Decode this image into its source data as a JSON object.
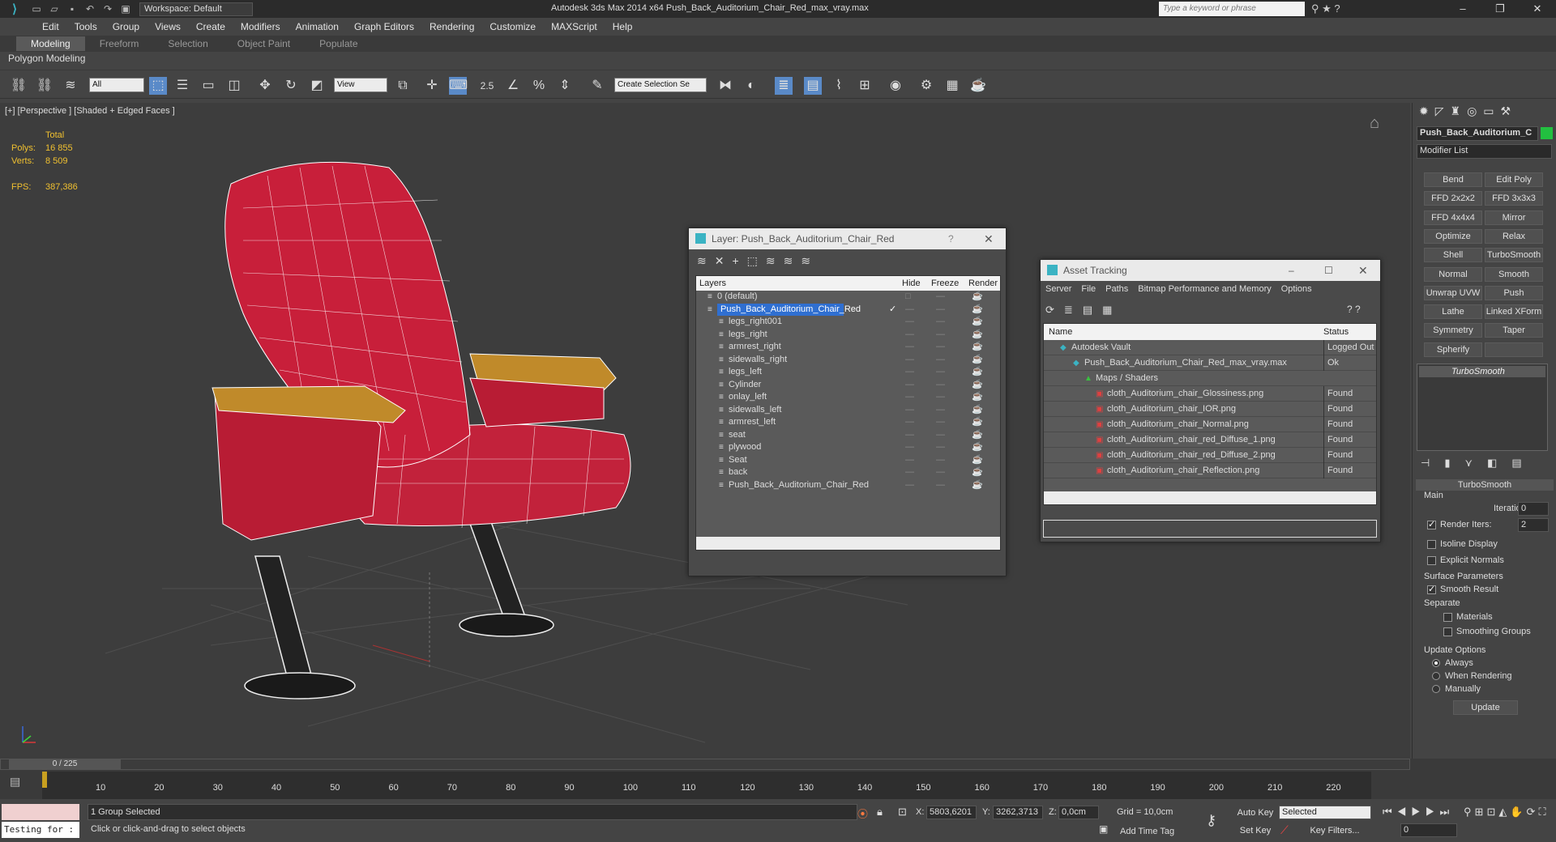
{
  "app": {
    "workspace": "Workspace: Default",
    "title": "Autodesk 3ds Max  2014 x64     Push_Back_Auditorium_Chair_Red_max_vray.max",
    "search_placeholder": "Type a keyword or phrase"
  },
  "menu": [
    "Edit",
    "Tools",
    "Group",
    "Views",
    "Create",
    "Modifiers",
    "Animation",
    "Graph Editors",
    "Rendering",
    "Customize",
    "MAXScript",
    "Help"
  ],
  "ribbon": {
    "tabs": [
      "Modeling",
      "Freeform",
      "Selection",
      "Object Paint",
      "Populate"
    ],
    "active": "Modeling",
    "subtitle": "Polygon Modeling"
  },
  "toolbar": {
    "filter": "All",
    "coord": "View",
    "snap_value": "2.5",
    "named_sel": "Create Selection Se"
  },
  "viewport": {
    "label": "[+] [Perspective ] [Shaded + Edged Faces ]",
    "stats": {
      "total_label": "Total",
      "polys_label": "Polys:",
      "polys": "16 855",
      "verts_label": "Verts:",
      "verts": "8 509",
      "fps_label": "FPS:",
      "fps": "387,386"
    }
  },
  "layer_dialog": {
    "title": "Layer: Push_Back_Auditorium_Chair_Red",
    "columns": [
      "Layers",
      "Hide",
      "Freeze",
      "Render"
    ],
    "rows": [
      {
        "name": "0 (default)",
        "level": 1
      },
      {
        "name": "Push_Back_Auditorium_Chair_Red",
        "level": 1,
        "selected": true
      },
      {
        "name": "legs_right001",
        "level": 2
      },
      {
        "name": "legs_right",
        "level": 2
      },
      {
        "name": "armrest_right",
        "level": 2
      },
      {
        "name": "sidewalls_right",
        "level": 2
      },
      {
        "name": "legs_left",
        "level": 2
      },
      {
        "name": "Cylinder",
        "level": 2
      },
      {
        "name": "onlay_left",
        "level": 2
      },
      {
        "name": "sidewalls_left",
        "level": 2
      },
      {
        "name": "armrest_left",
        "level": 2
      },
      {
        "name": "seat",
        "level": 2
      },
      {
        "name": "plywood",
        "level": 2
      },
      {
        "name": "Seat",
        "level": 2
      },
      {
        "name": "back",
        "level": 2
      },
      {
        "name": "Push_Back_Auditorium_Chair_Red",
        "level": 2
      }
    ]
  },
  "asset_dialog": {
    "title": "Asset Tracking",
    "menu": [
      "Server",
      "File",
      "Paths",
      "Bitmap Performance and Memory",
      "Options"
    ],
    "columns": [
      "Name",
      "Status"
    ],
    "rows": [
      {
        "name": "Autodesk Vault",
        "status": "Logged Out",
        "level": 1
      },
      {
        "name": "Push_Back_Auditorium_Chair_Red_max_vray.max",
        "status": "Ok",
        "level": 2
      },
      {
        "name": "Maps / Shaders",
        "status": "",
        "level": 3
      },
      {
        "name": "cloth_Auditorium_chair_Glossiness.png",
        "status": "Found",
        "level": 4
      },
      {
        "name": "cloth_Auditorium_chair_IOR.png",
        "status": "Found",
        "level": 4
      },
      {
        "name": "cloth_Auditorium_chair_Normal.png",
        "status": "Found",
        "level": 4
      },
      {
        "name": "cloth_Auditorium_chair_red_Diffuse_1.png",
        "status": "Found",
        "level": 4
      },
      {
        "name": "cloth_Auditorium_chair_red_Diffuse_2.png",
        "status": "Found",
        "level": 4
      },
      {
        "name": "cloth_Auditorium_chair_Reflection.png",
        "status": "Found",
        "level": 4
      }
    ]
  },
  "command_panel": {
    "object_name": "Push_Back_Auditorium_C",
    "modifier_list": "Modifier List",
    "buttons": [
      "Bend",
      "Edit Poly",
      "FFD 2x2x2",
      "FFD 3x3x3",
      "FFD 4x4x4",
      "Mirror",
      "Optimize",
      "Relax",
      "Shell",
      "TurboSmooth",
      "Normal",
      "Smooth",
      "Unwrap UVW",
      "Push",
      "Lathe",
      "Linked XForm",
      "Symmetry",
      "Taper",
      "Spherify",
      ""
    ],
    "stack_item": "TurboSmooth",
    "rollout": {
      "title": "TurboSmooth",
      "main": "Main",
      "iterations_label": "Iterations:",
      "iterations": "0",
      "render_iters_label": "Render Iters:",
      "render_iters": "2",
      "isoline": "Isoline Display",
      "explicit": "Explicit Normals",
      "surface": "Surface Parameters",
      "smooth_result": "Smooth Result",
      "separate": "Separate",
      "materials": "Materials",
      "smoothing_groups": "Smoothing Groups",
      "update_options": "Update Options",
      "always": "Always",
      "when_rendering": "When Rendering",
      "manually": "Manually",
      "update": "Update"
    }
  },
  "timeline": {
    "frame": "0 / 225",
    "ticks": [
      "10",
      "20",
      "30",
      "40",
      "50",
      "60",
      "70",
      "80",
      "90",
      "100",
      "110",
      "120",
      "130",
      "140",
      "150",
      "160",
      "170",
      "180",
      "190",
      "200",
      "210",
      "220"
    ]
  },
  "status": {
    "script": "Testing for :",
    "selected": "1 Group Selected",
    "prompt": "Click or click-and-drag to select objects",
    "x_label": "X:",
    "x": "5803,6201",
    "y_label": "Y:",
    "y": "3262,3713",
    "z_label": "Z:",
    "z": "0,0cm",
    "grid": "Grid = 10,0cm",
    "add_time_tag": "Add Time Tag",
    "auto_key": "Auto Key",
    "set_key": "Set Key",
    "key_mode": "Selected",
    "key_filters": "Key Filters...",
    "frame_field": "0"
  }
}
